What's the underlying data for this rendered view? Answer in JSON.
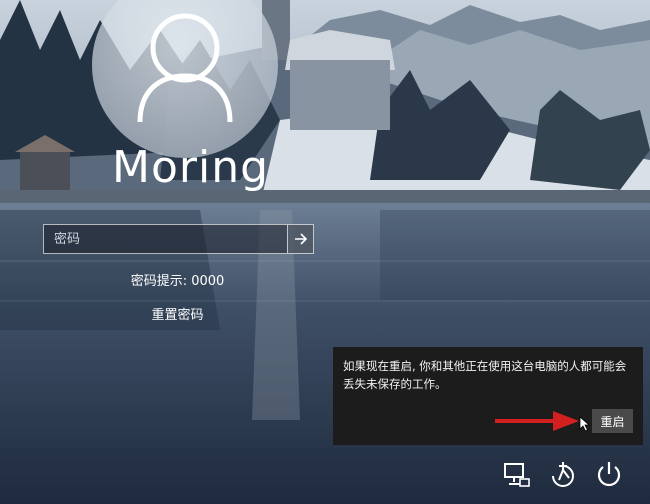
{
  "user": {
    "name": "Moring"
  },
  "password": {
    "placeholder": "密码",
    "hint": "密码提示: 0000",
    "reset_label": "重置密码"
  },
  "notice": {
    "message": "如果现在重启, 你和其他正在使用这台电脑的人都可能会丢失未保存的工作。",
    "restart_label": "重启"
  },
  "tray": {
    "icons": [
      "network-icon",
      "accessibility-icon",
      "power-icon"
    ]
  }
}
